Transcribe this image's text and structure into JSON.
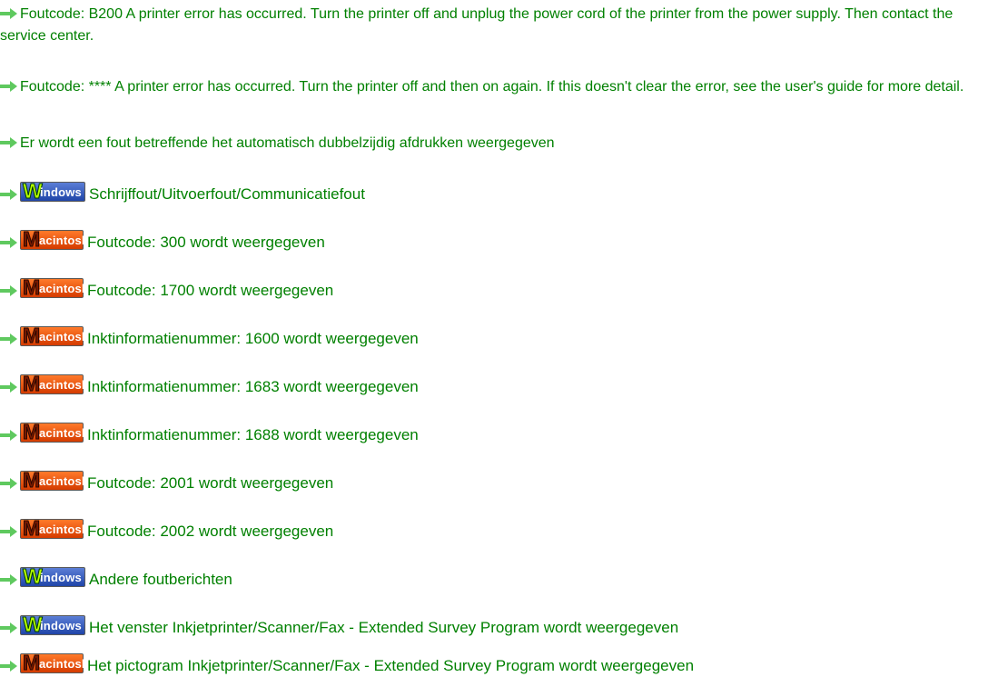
{
  "colors": {
    "link_text": "#008000",
    "arrow": "#5fc95f",
    "windows_badge_bg": "#2f55bb",
    "windows_badge_initial": "#b6ff00",
    "mac_badge_bg": "#f05a10"
  },
  "badges": {
    "windows": {
      "initial": "W",
      "rest": "indows"
    },
    "mac": {
      "initial": "M",
      "rest": "acintosh"
    }
  },
  "items": [
    {
      "icon": "arrow-right-icon",
      "badge": "",
      "text": "Foutcode: B200 A printer error has occurred. Turn the printer off and unplug the power cord of the printer from the power supply. Then contact the service center."
    },
    {
      "icon": "arrow-right-icon",
      "badge": "",
      "text": "Foutcode: **** A printer error has occurred. Turn the printer off and then on again. If this doesn't clear the error, see the user's guide for more detail."
    },
    {
      "icon": "arrow-right-icon",
      "badge": "",
      "text": "Er wordt een fout betreffende het automatisch dubbelzijdig afdrukken weergegeven"
    },
    {
      "icon": "arrow-right-icon",
      "badge": "windows",
      "text": "Schrijffout/Uitvoerfout/Communicatiefout"
    },
    {
      "icon": "arrow-right-icon",
      "badge": "mac",
      "text": "Foutcode: 300 wordt weergegeven"
    },
    {
      "icon": "arrow-right-icon",
      "badge": "mac",
      "text": "Foutcode: 1700 wordt weergegeven"
    },
    {
      "icon": "arrow-right-icon",
      "badge": "mac",
      "text": "Inktinformatienummer: 1600 wordt weergegeven"
    },
    {
      "icon": "arrow-right-icon",
      "badge": "mac",
      "text": "Inktinformatienummer: 1683 wordt weergegeven"
    },
    {
      "icon": "arrow-right-icon",
      "badge": "mac",
      "text": "Inktinformatienummer: 1688 wordt weergegeven"
    },
    {
      "icon": "arrow-right-icon",
      "badge": "mac",
      "text": "Foutcode: 2001 wordt weergegeven"
    },
    {
      "icon": "arrow-right-icon",
      "badge": "mac",
      "text": "Foutcode: 2002 wordt weergegeven"
    },
    {
      "icon": "arrow-right-icon",
      "badge": "windows",
      "text": "Andere foutberichten"
    },
    {
      "icon": "arrow-right-icon",
      "badge": "windows",
      "text": "Het venster Inkjetprinter/Scanner/Fax - Extended Survey Program wordt weergegeven"
    },
    {
      "icon": "arrow-right-icon",
      "badge": "mac",
      "text": "Het pictogram Inkjetprinter/Scanner/Fax - Extended Survey Program wordt weergegeven"
    }
  ]
}
